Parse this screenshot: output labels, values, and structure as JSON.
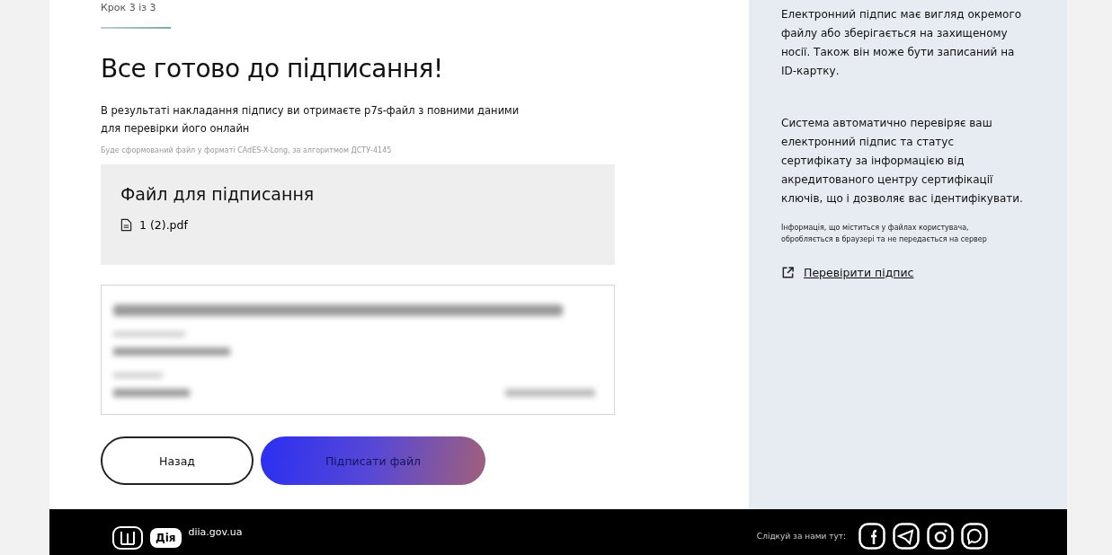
{
  "step": "Крок 3 із 3",
  "title": "Все готово до підписання!",
  "description": "В результаті накладання підпису ви отримаєте p7s-файл з повними даними для перевірки його онлайн",
  "format_note": "Буде сформований файл у форматі CAdES-X-Long, за алгоритмом ДСТУ-4145",
  "file_card": {
    "title": "Файл для підписання",
    "files": [
      "1 (2).pdf"
    ]
  },
  "buttons": [
    {
      "label": "Назад",
      "kind": "secondary"
    },
    {
      "label": "Підписати файл",
      "kind": "primary"
    }
  ],
  "sidebar": {
    "paragraphs": [
      "Електронний підпис має вигляд окремого файлу або зберігається на захищеному носії. Також він може бути записаний на ID-картку.",
      "Система автоматично перевіряє ваш електронний підпис та статус сертифікату за інформацією від акредитованого центру сертифікації ключів, що і дозволяє вас ідентифікувати."
    ],
    "note": "Інформація, що міститься у файлах користувача, обробляється в браузері та не передається на сервер",
    "link": "Перевірити підпис"
  },
  "footer": {
    "logo": "Дія",
    "site": "diia.gov.ua",
    "follow": "Слідкуй за нами тут:"
  }
}
